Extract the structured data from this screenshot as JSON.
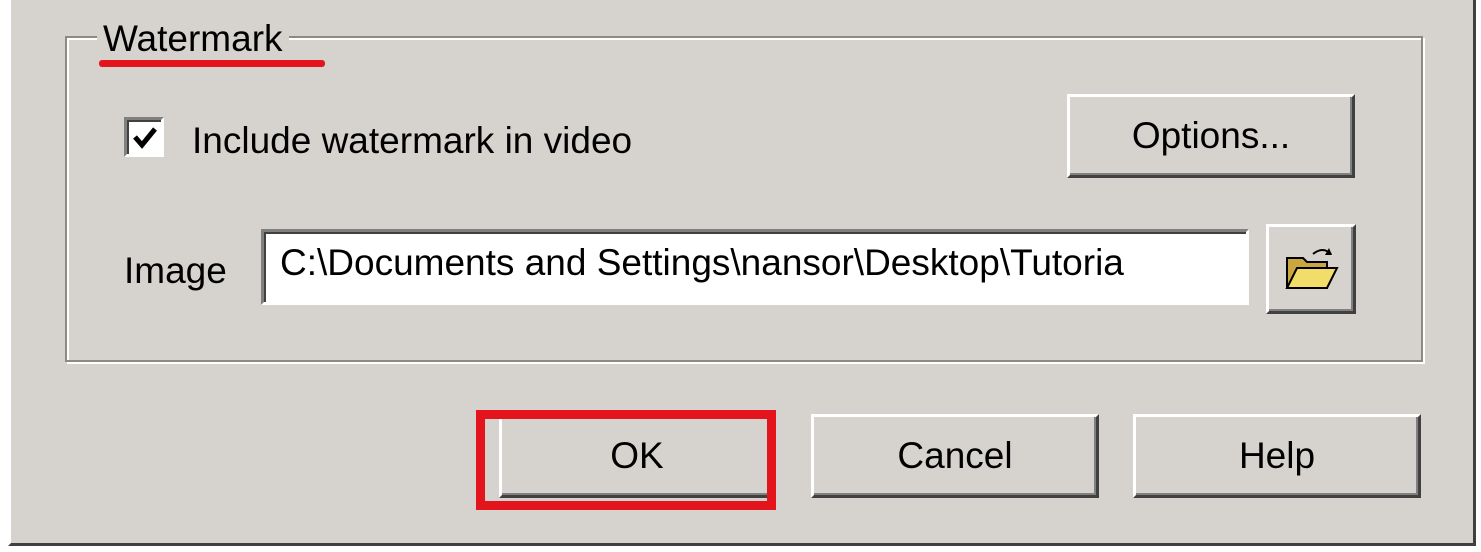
{
  "group": {
    "title": "Watermark"
  },
  "checkbox": {
    "label": "Include watermark in video",
    "checked": true
  },
  "options_button": {
    "label": "Options..."
  },
  "image": {
    "label": "Image",
    "value": "C:\\Documents and Settings\\nansor\\Desktop\\Tutoria"
  },
  "buttons": {
    "ok": "OK",
    "cancel": "Cancel",
    "help": "Help"
  },
  "icons": {
    "browse": "folder-open-icon",
    "check": "checkmark-icon"
  },
  "colors": {
    "highlight": "#e4141c",
    "dialog_bg": "#d6d3ce"
  }
}
